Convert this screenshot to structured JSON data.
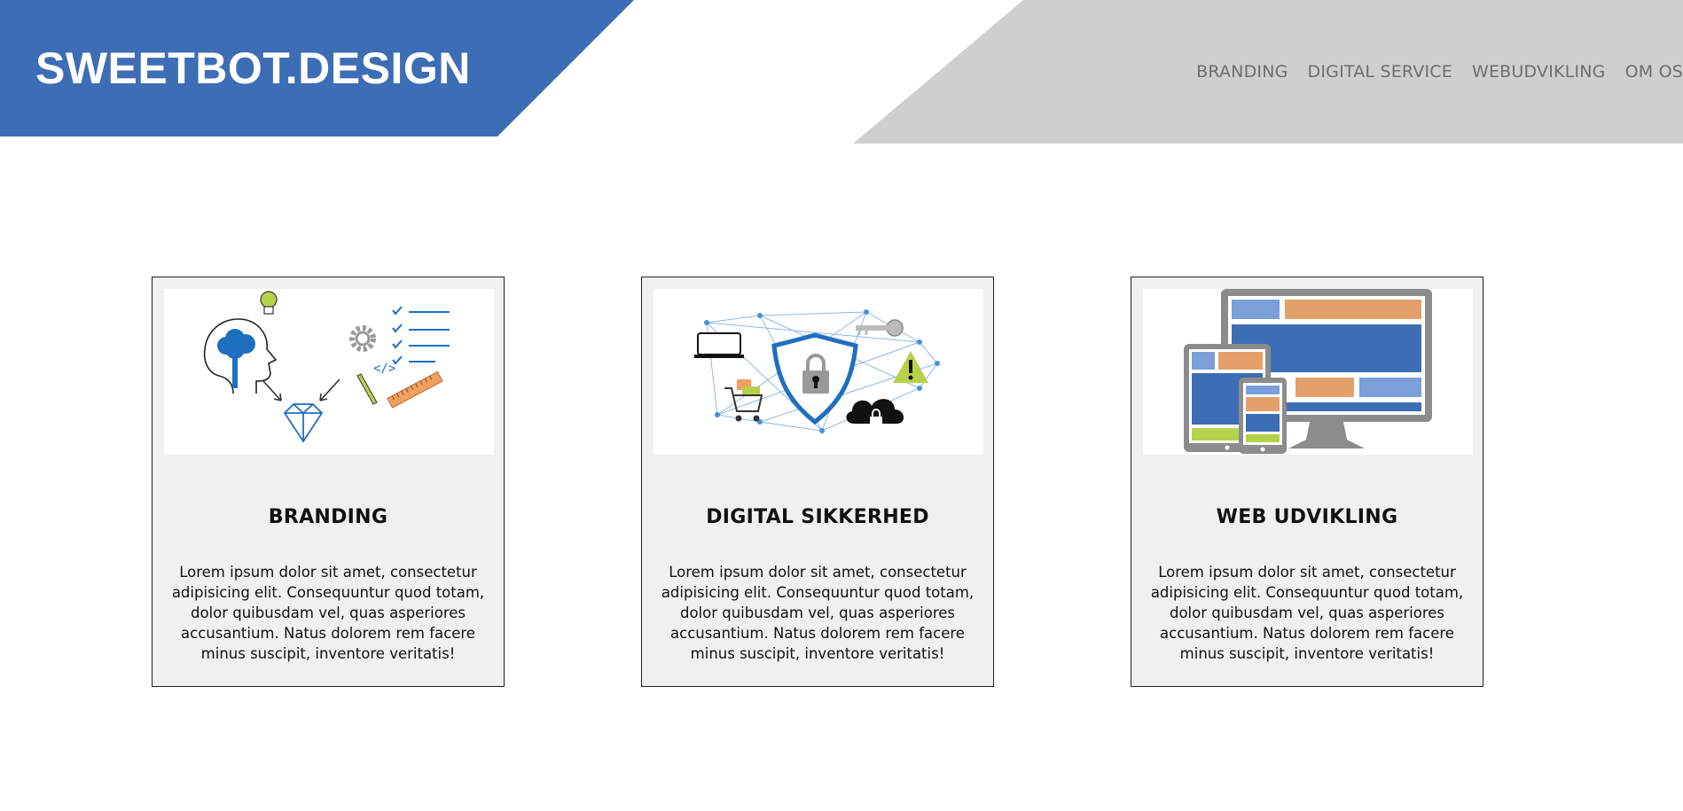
{
  "colors": {
    "brand": "#3d6db5",
    "nav_band": "#cfcfcd",
    "card_bg": "#f0f0ee"
  },
  "header": {
    "logo": "SWEETBOT.DESIGN",
    "nav": [
      "BRANDING",
      "DIGITAL SERVICE",
      "WEBUDVIKLING",
      "OM OS"
    ]
  },
  "cards": [
    {
      "title": "BRANDING",
      "text": "Lorem ipsum dolor sit amet, consectetur adipisicing elit. Consequuntur quod totam, dolor quibusdam vel, quas asperiores accusantium. Natus dolorem rem facere minus suscipit, inventore veritatis!",
      "icon": "branding-illustration"
    },
    {
      "title": "DIGITAL SIKKERHED",
      "text": "Lorem ipsum dolor sit amet, consectetur adipisicing elit. Consequuntur quod totam, dolor quibusdam vel, quas asperiores accusantium. Natus dolorem rem facere minus suscipit, inventore veritatis!",
      "icon": "security-network-illustration"
    },
    {
      "title": "WEB UDVIKLING",
      "text": "Lorem ipsum dolor sit amet, consectetur adipisicing elit. Consequuntur quod totam, dolor quibusdam vel, quas asperiores accusantium. Natus dolorem rem facere minus suscipit, inventore veritatis!",
      "icon": "responsive-devices-illustration"
    }
  ]
}
